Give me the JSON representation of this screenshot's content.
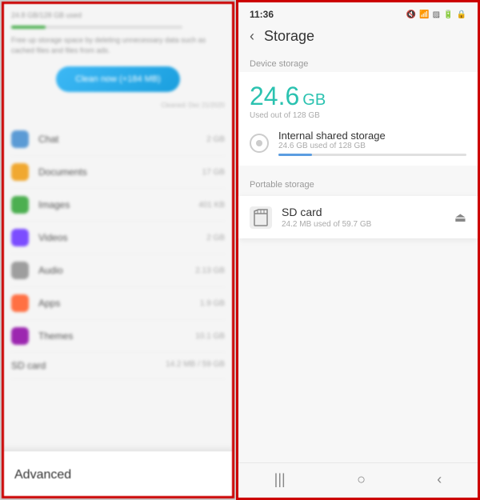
{
  "left": {
    "storage_used": "24.8 GB/128 GB used",
    "description": "Free up storage space by deleting unnecessary data such as cached files and files from ads.",
    "clean_button": "Clean now (+184 MB)",
    "clean_date": "Cleaned: Dec 21/2020",
    "items": [
      {
        "name": "Chat",
        "size": "2 GB",
        "icon_class": "icon-chat"
      },
      {
        "name": "Documents",
        "size": "17 GB",
        "icon_class": "icon-docs"
      },
      {
        "name": "Images",
        "size": "401 KB",
        "icon_class": "icon-images"
      },
      {
        "name": "Videos",
        "size": "2 GB",
        "icon_class": "icon-videos"
      },
      {
        "name": "Audio",
        "size": "2.13 GB",
        "icon_class": "icon-audio"
      },
      {
        "name": "Apps",
        "size": "1.9 GB",
        "icon_class": "icon-apps"
      },
      {
        "name": "Themes",
        "size": "10.1 GB",
        "icon_class": "icon-themes"
      }
    ],
    "sdcard_label": "SD card",
    "sdcard_size": "14.2 MB / 59 GB",
    "advanced_label": "Advanced"
  },
  "right": {
    "status_time": "11:36",
    "status_icons": "◀ ⬛ ▨ ⬛ 🔒",
    "back_arrow": "‹",
    "title": "Storage",
    "device_storage_label": "Device storage",
    "storage_amount": "24.6",
    "storage_unit": "GB",
    "storage_used_text": "Used out of 128 GB",
    "internal_title": "Internal shared storage",
    "internal_used": "24.6 GB used of 128 GB",
    "portable_label": "Portable storage",
    "sdcard_name": "SD card",
    "sdcard_used": "24.2 MB used of 59.7 GB",
    "nav_icons": [
      "|||",
      "○",
      "‹"
    ]
  }
}
